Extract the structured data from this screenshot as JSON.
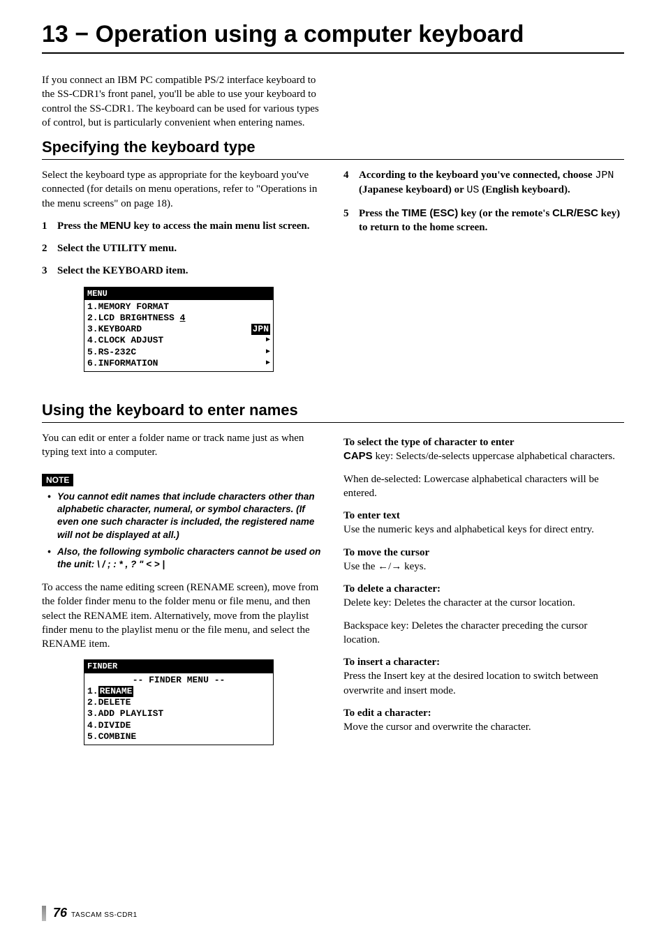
{
  "title": "13 − Operation using a computer keyboard",
  "intro": "If you connect an IBM PC compatible PS/2 interface keyboard to the SS-CDR1's front panel, you'll be able to use your keyboard to control the SS-CDR1. The keyboard can be used for various types of control, but is particularly convenient when entering names.",
  "sectionA": {
    "heading": "Specifying the keyboard type",
    "left": {
      "para": "Select the keyboard type as appropriate for the keyboard you've connected (for details on menu operations, refer to \"Operations in the menu screens\" on page 18).",
      "steps": {
        "s1_pre": "Press the ",
        "s1_key": "MENU",
        "s1_post": " key to access the main menu list screen.",
        "s2": "Select the UTILITY menu.",
        "s3": "Select the KEYBOARD item."
      }
    },
    "lcd1": {
      "title": "MENU",
      "r1": "1.MEMORY FORMAT",
      "r2a": "2.LCD BRIGHTNESS ",
      "r2b": "4",
      "r3a": "3.KEYBOARD",
      "r3b": "JPN",
      "r4": "4.CLOCK ADJUST",
      "r5": "5.RS-232C",
      "r6": "6.INFORMATION"
    },
    "right": {
      "s4_pre": "According to the keyboard you've connected, choose ",
      "s4_jpn": "JPN",
      "s4_mid": " (Japanese keyboard) or ",
      "s4_us": "US",
      "s4_post": " (English keyboard).",
      "s5_pre": "Press the ",
      "s5_k1": "TIME (ESC)",
      "s5_mid": " key (or the remote's ",
      "s5_k2": "CLR/ESC",
      "s5_post": " key) to return to the home screen."
    }
  },
  "sectionB": {
    "heading": "Using the keyboard to enter names",
    "left": {
      "p1": "You can edit or enter a folder name or track name just as when typing text into a computer.",
      "noteLabel": "NOTE",
      "note1": "You cannot edit names that include characters other than alphabetic character, numeral, or symbol characters. (If even one such character is included, the registered name will not be displayed at all.)",
      "note2": "Also, the following symbolic characters cannot be used on the unit: \\ / ; : * , ? \" < > |",
      "p2": "To access the name editing screen (RENAME screen), move from the folder finder menu to the folder menu or file menu, and then select the RENAME item. Alternatively, move from the playlist finder menu to the playlist menu or the file menu, and select the RENAME item."
    },
    "lcd2": {
      "title": "FINDER",
      "h": "-- FINDER MENU --",
      "r1a": "1.",
      "r1b": "RENAME",
      "r2": "2.DELETE",
      "r3": "3.ADD PLAYLIST",
      "r4": "4.DIVIDE",
      "r5": "5.COMBINE"
    },
    "right": {
      "h1": "To select the type of character to enter",
      "p1a": "CAPS",
      "p1b": " key: Selects/de-selects uppercase alphabetical characters.",
      "p2": "When de-selected: Lowercase alphabetical characters will be entered.",
      "h2": "To enter text",
      "p3": "Use the numeric keys and alphabetical keys for direct entry.",
      "h3": "To move the cursor",
      "p4a": "Use the ",
      "p4b": " keys.",
      "h4": "To delete a character:",
      "p5": "Delete key: Deletes the character at the cursor location.",
      "p6": "Backspace key: Deletes the character preceding the cursor location.",
      "h5": "To insert a character:",
      "p7": "Press the Insert key at the desired location to switch between overwrite and insert mode.",
      "h6": "To edit a character:",
      "p8": "Move the cursor and overwrite the character."
    }
  },
  "footer": {
    "page": "76",
    "product": "TASCAM  SS-CDR1"
  }
}
